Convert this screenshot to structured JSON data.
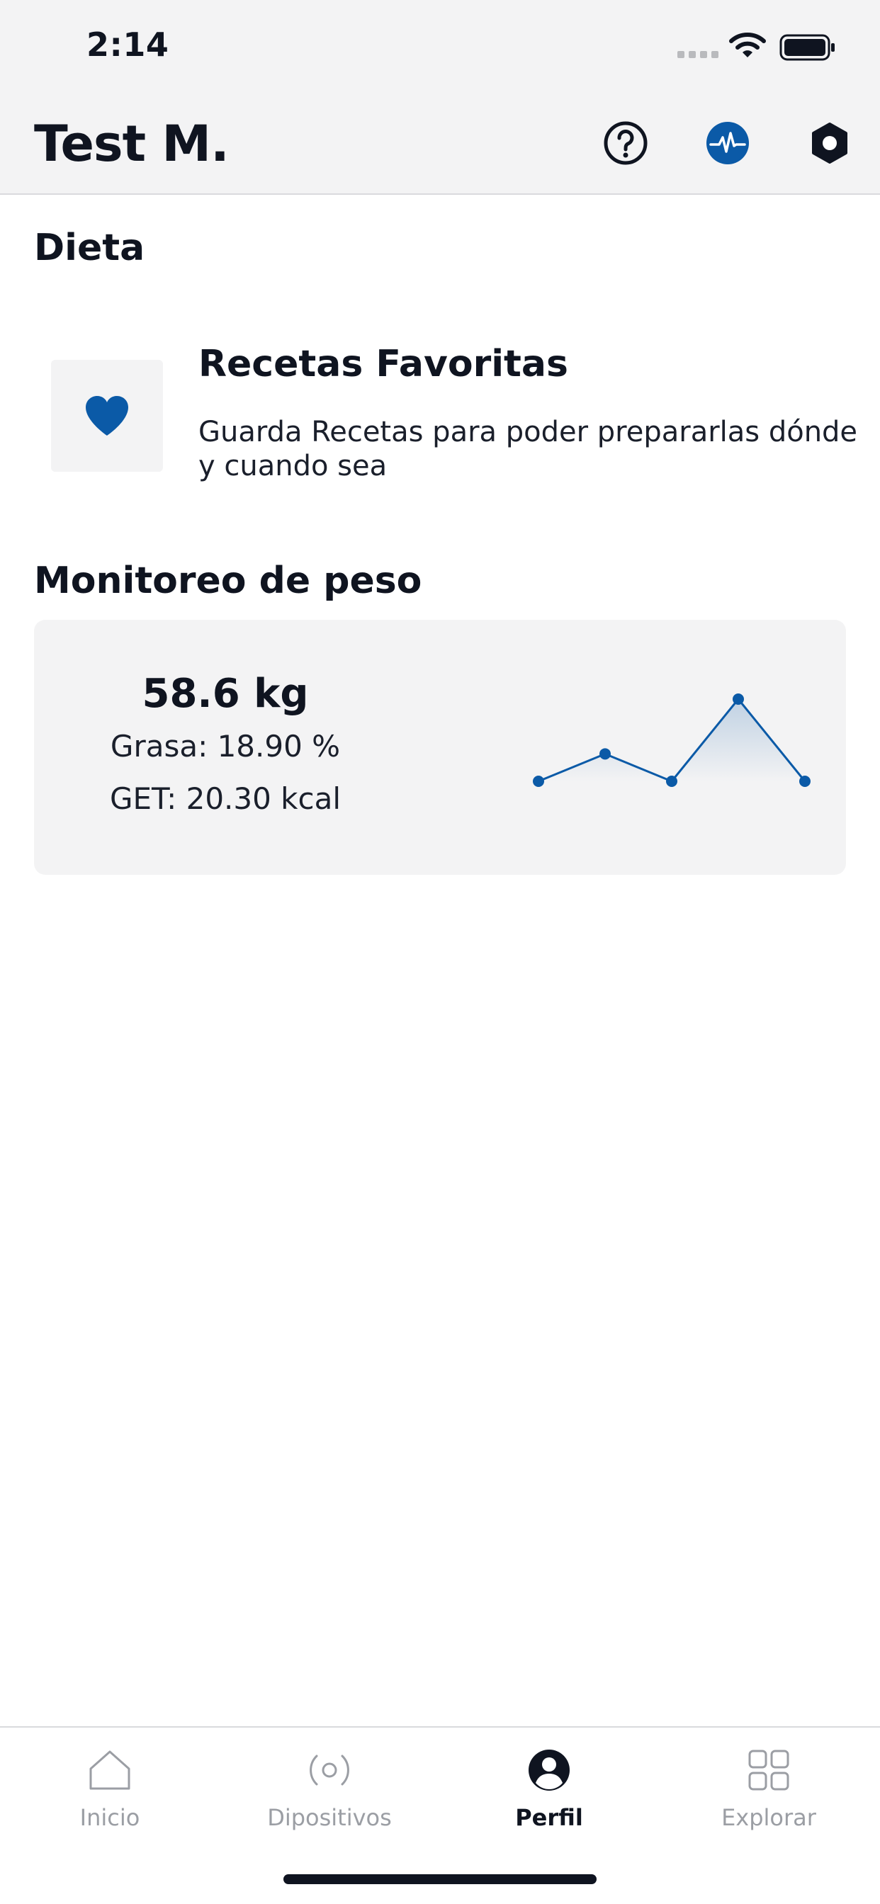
{
  "status_bar": {
    "time": "2:14"
  },
  "header": {
    "title": "Test M."
  },
  "diet": {
    "section_title": "Dieta",
    "favorites": {
      "title": "Recetas Favoritas",
      "description": "Guarda Recetas para poder prepararlas dónde y cuando sea"
    }
  },
  "weight": {
    "section_title": "Monitoreo de peso",
    "value": "58.6 kg",
    "fat": "Grasa: 18.90 %",
    "get": "GET: 20.30 kcal",
    "trend": [
      2,
      3,
      2,
      5,
      2
    ]
  },
  "tabs": [
    {
      "label": "Inicio",
      "icon": "home-icon",
      "active": false
    },
    {
      "label": "Dipositivos",
      "icon": "devices-icon",
      "active": false
    },
    {
      "label": "Perfil",
      "icon": "profile-icon",
      "active": true
    },
    {
      "label": "Explorar",
      "icon": "explore-icon",
      "active": false
    }
  ],
  "colors": {
    "accent": "#0b5aa7",
    "text": "#0f1420",
    "muted": "#9b9ea4",
    "card_bg": "#f3f3f4"
  }
}
